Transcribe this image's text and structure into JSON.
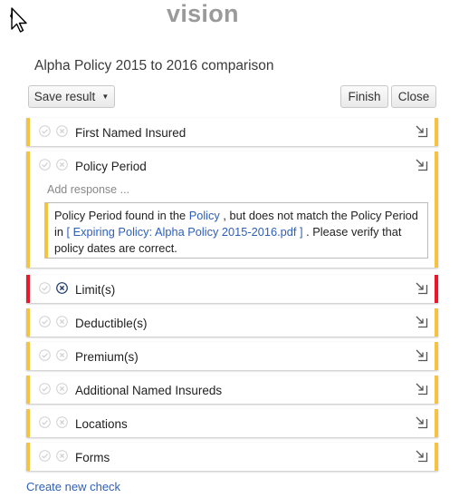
{
  "app": {
    "logo_text": "vision"
  },
  "header": {
    "title": "Alpha Policy 2015 to 2016 comparison"
  },
  "toolbar": {
    "save_label": "Save result",
    "finish_label": "Finish",
    "close_label": "Close"
  },
  "checks": [
    {
      "label": "First Named Insured",
      "status": "warning"
    },
    {
      "label": "Policy Period",
      "status": "warning"
    },
    {
      "label": "Limit(s)",
      "status": "error"
    },
    {
      "label": "Deductible(s)",
      "status": "warning"
    },
    {
      "label": "Premium(s)",
      "status": "warning"
    },
    {
      "label": "Additional Named Insureds",
      "status": "warning"
    },
    {
      "label": "Locations",
      "status": "warning"
    },
    {
      "label": "Forms",
      "status": "warning"
    }
  ],
  "policy_period": {
    "add_response_placeholder": "Add response ...",
    "note_part1": "Policy Period found in the ",
    "note_link1": "Policy",
    "note_part2": " , but does not match the Policy Period in ",
    "note_link2": "[ Expiring Policy: Alpha Policy 2015-2016.pdf ]",
    "note_part3": " . Please verify that policy dates are correct."
  },
  "footer": {
    "create_link": "Create new check"
  },
  "colors": {
    "warning": "#f5c344",
    "error": "#e8192c",
    "link": "#2f5fb8"
  },
  "icons": [
    "cursor-arrow-icon",
    "checkmark-icon",
    "close-x-icon",
    "expand-arrow-icon",
    "caret-down-icon"
  ]
}
